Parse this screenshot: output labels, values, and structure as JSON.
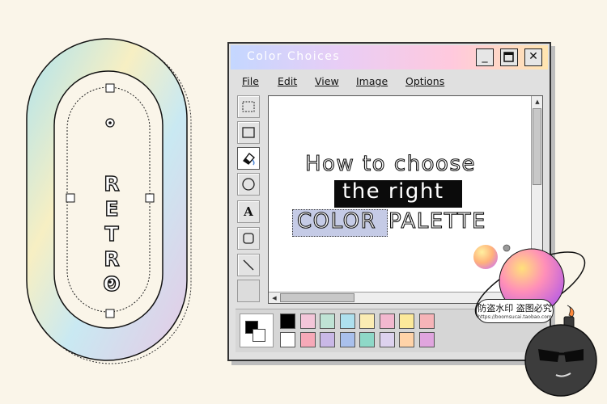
{
  "badge": {
    "letters": [
      "R",
      "E",
      "T",
      "R",
      "O"
    ]
  },
  "window": {
    "title": "Color Choices",
    "controls": {
      "minimize": "_",
      "maximize": "□",
      "close": "✕"
    },
    "menu": [
      "File",
      "Edit",
      "View",
      "Image",
      "Options"
    ],
    "tools": [
      "select-rect-icon",
      "rectangle-icon",
      "fill-bucket-icon",
      "ellipse-icon",
      "text-tool-icon",
      "rounded-rect-icon",
      "line-icon"
    ],
    "text_tool_glyph": "A",
    "canvas": {
      "line1": "How to choose",
      "line2": "the right",
      "line3_selected": "COLOR",
      "line3_rest": "PALETTE"
    },
    "palette": {
      "foreground": "#000000",
      "background": "#ffffff",
      "top_row": [
        "#000000",
        "#f3c6d9",
        "#bfe3d5",
        "#aee0ee",
        "#fbecb3",
        "#f2b8cf",
        "#fce99a",
        "#f6b4b8"
      ],
      "bottom_row": [
        "#ffffff",
        "#f6a9b8",
        "#c9b8e6",
        "#a9c0ec",
        "#8ed8c7",
        "#ddd2ee",
        "#ffd3a8",
        "#e0a5de"
      ]
    }
  },
  "watermark": {
    "text_zh": "防盗水印 盗图必究",
    "text_en": "https://boomsucai.taobao.com"
  }
}
